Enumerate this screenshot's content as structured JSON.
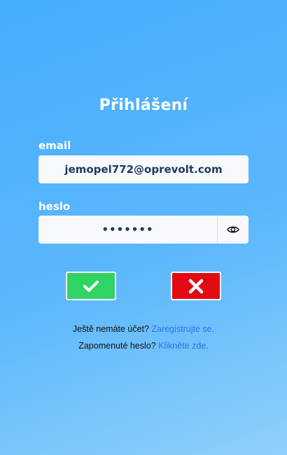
{
  "login": {
    "title": "Přihlášení",
    "email_label": "email",
    "email_value": "jemopel772@oprevolt.com",
    "password_label": "heslo",
    "password_value": "•••••••",
    "show_password_icon": "eye-icon",
    "submit_icon": "checkmark-icon",
    "cancel_icon": "x-icon"
  },
  "footer": {
    "no_account_text": "Ještě nemáte účet?",
    "register_link": "Zaregistrujte se.",
    "forgot_text": "Zapomenuté heslo?",
    "forgot_link": "Klikněte zde."
  },
  "colors": {
    "submit": "#2fd462",
    "cancel": "#e30a14",
    "link": "#2f6ff0"
  }
}
